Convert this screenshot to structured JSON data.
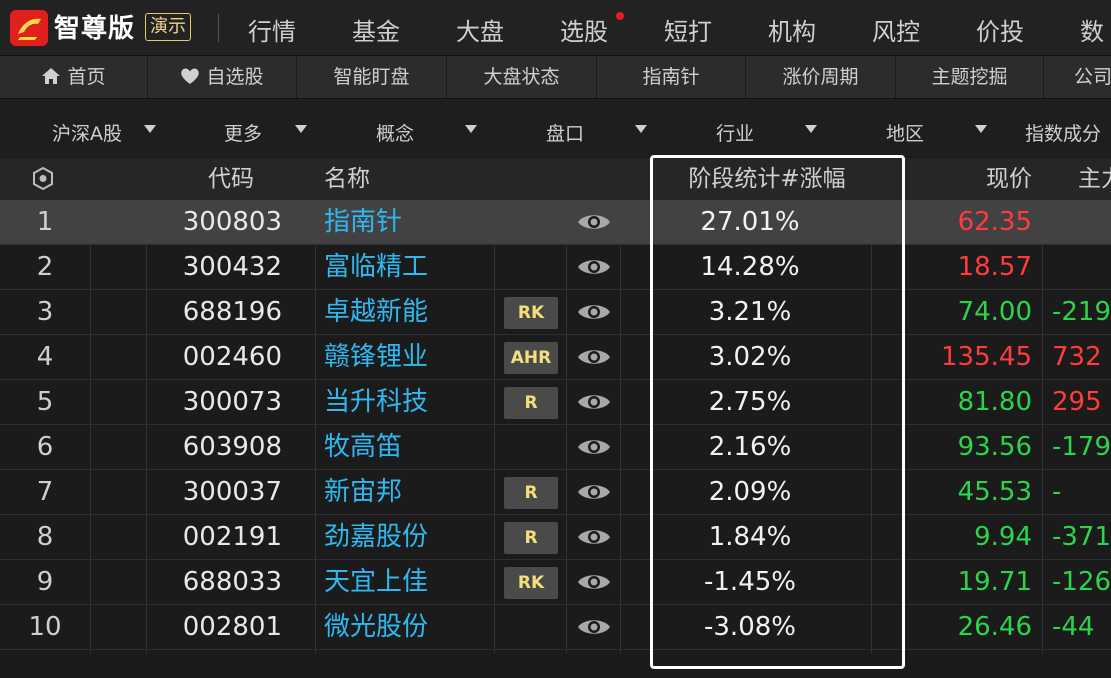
{
  "app": {
    "brand": "智尊版",
    "demo_badge": "演示"
  },
  "top_nav": [
    {
      "label": "行情"
    },
    {
      "label": "基金"
    },
    {
      "label": "大盘"
    },
    {
      "label": "选股"
    },
    {
      "label": "短打"
    },
    {
      "label": "机构"
    },
    {
      "label": "风控"
    },
    {
      "label": "价投"
    },
    {
      "label": "数"
    }
  ],
  "sub_nav": [
    {
      "label": "首页",
      "icon": "home-icon"
    },
    {
      "label": "自选股",
      "icon": "heart-icon"
    },
    {
      "label": "智能盯盘"
    },
    {
      "label": "大盘状态"
    },
    {
      "label": "指南针"
    },
    {
      "label": "涨价周期"
    },
    {
      "label": "主题挖掘"
    },
    {
      "label": "公司"
    }
  ],
  "filters": [
    {
      "label": "沪深A股"
    },
    {
      "label": "更多"
    },
    {
      "label": "概念"
    },
    {
      "label": "盘口"
    },
    {
      "label": "行业"
    },
    {
      "label": "地区"
    },
    {
      "label": "指数成分"
    }
  ],
  "table": {
    "headers": {
      "settings_icon": "settings-icon",
      "code": "代码",
      "name": "名称",
      "stage": "阶段统计#涨幅",
      "price": "现价",
      "main": "主力"
    },
    "rows": [
      {
        "num": "1",
        "code": "300803",
        "name": "指南针",
        "tag": "",
        "stage": "27.01%",
        "price": "62.35",
        "price_color": "#ff3b3b",
        "main": "",
        "main_color": ""
      },
      {
        "num": "2",
        "code": "300432",
        "name": "富临精工",
        "tag": "",
        "stage": "14.28%",
        "price": "18.57",
        "price_color": "#ff3b3b",
        "main": "",
        "main_color": ""
      },
      {
        "num": "3",
        "code": "688196",
        "name": "卓越新能",
        "tag": "RK",
        "stage": "3.21%",
        "price": "74.00",
        "price_color": "#2bd44a",
        "main": "-219",
        "main_color": "#2bd44a"
      },
      {
        "num": "4",
        "code": "002460",
        "name": "赣锋锂业",
        "tag": "AHR",
        "stage": "3.02%",
        "price": "135.45",
        "price_color": "#ff3b3b",
        "main": "732",
        "main_color": "#ff3b3b"
      },
      {
        "num": "5",
        "code": "300073",
        "name": "当升科技",
        "tag": "R",
        "stage": "2.75%",
        "price": "81.80",
        "price_color": "#2bd44a",
        "main": "295",
        "main_color": "#ff3b3b"
      },
      {
        "num": "6",
        "code": "603908",
        "name": "牧高笛",
        "tag": "",
        "stage": "2.16%",
        "price": "93.56",
        "price_color": "#2bd44a",
        "main": "-179",
        "main_color": "#2bd44a"
      },
      {
        "num": "7",
        "code": "300037",
        "name": "新宙邦",
        "tag": "R",
        "stage": "2.09%",
        "price": "45.53",
        "price_color": "#2bd44a",
        "main": "-",
        "main_color": "#2bd44a"
      },
      {
        "num": "8",
        "code": "002191",
        "name": "劲嘉股份",
        "tag": "R",
        "stage": "1.84%",
        "price": "9.94",
        "price_color": "#2bd44a",
        "main": "-371",
        "main_color": "#2bd44a"
      },
      {
        "num": "9",
        "code": "688033",
        "name": "天宜上佳",
        "tag": "RK",
        "stage": "-1.45%",
        "price": "19.71",
        "price_color": "#2bd44a",
        "main": "-126",
        "main_color": "#2bd44a"
      },
      {
        "num": "10",
        "code": "002801",
        "name": "微光股份",
        "tag": "",
        "stage": "-3.08%",
        "price": "26.46",
        "price_color": "#2bd44a",
        "main": "-44",
        "main_color": "#2bd44a"
      }
    ]
  }
}
